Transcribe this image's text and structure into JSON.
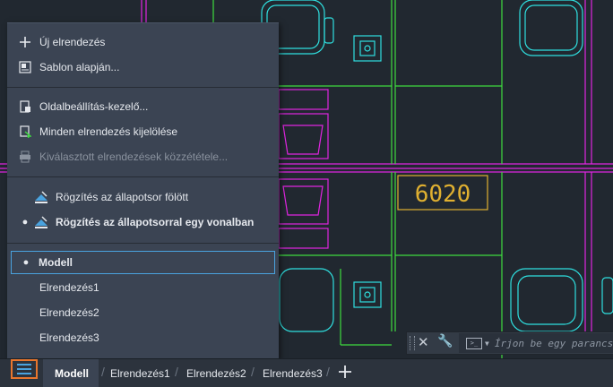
{
  "drawing": {
    "room_number": "6020"
  },
  "menu": {
    "new_layout": "Új elrendezés",
    "from_template": "Sablon alapján...",
    "page_setup": "Oldalbeállítás-kezelő...",
    "select_all": "Minden elrendezés kijelölése",
    "publish_selected": "Kiválasztott elrendezések közzététele...",
    "pin_above": "Rögzítés az állapotsor fölött",
    "pin_inline": "Rögzítés az állapotsorral egy vonalban",
    "layouts": [
      "Modell",
      "Elrendezés1",
      "Elrendezés2",
      "Elrendezés3"
    ]
  },
  "tabs": [
    "Modell",
    "Elrendezés1",
    "Elrendezés2",
    "Elrendezés3"
  ],
  "command": {
    "placeholder": "Írjon be egy parancs"
  },
  "colors": {
    "accent": "#e8762d",
    "selection": "#4aa3df",
    "green": "#3fdc3f",
    "magenta": "#e025e0",
    "cyan": "#2fe0e0",
    "yellow": "#e0b030"
  }
}
